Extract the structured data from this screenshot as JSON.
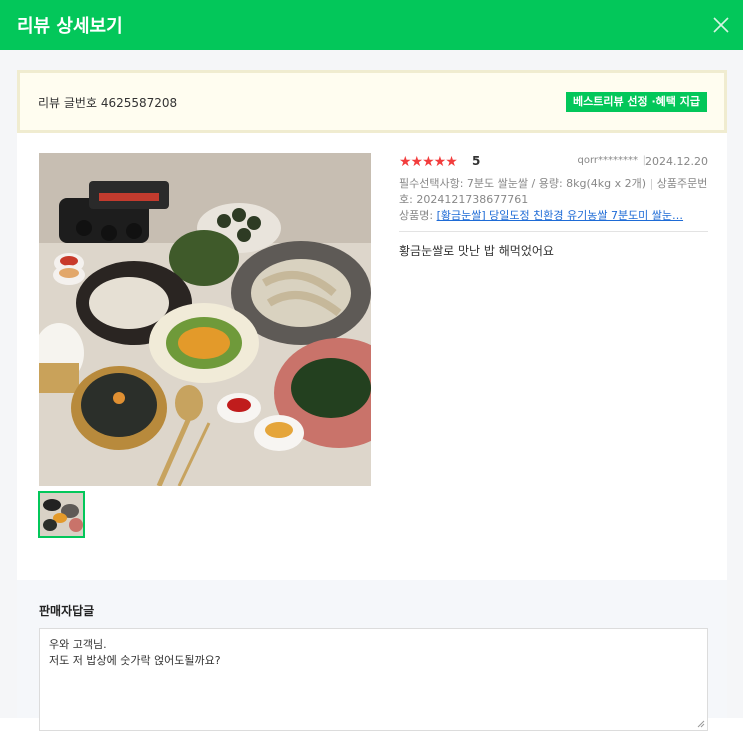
{
  "modal": {
    "title": "리뷰 상세보기",
    "close_icon": "close-icon"
  },
  "notice": {
    "review_number": "리뷰 글번호 4625587208",
    "badge": "베스트리뷰 선정 ·혜택 지급"
  },
  "review": {
    "stars": "★★★★★",
    "score": "5",
    "rating_value": 5,
    "rating_max": 5,
    "user": "qorr********",
    "date": "2024.12.20",
    "options_text": "필수선택사항: 7분도 쌀눈쌀 / 용량: 8kg(4kg x 2개)",
    "order_label": "상품주문번호: 2024121738677761",
    "product_label": "상품명:",
    "product_link": "[황금눈쌀] 당일도정 친환경 유기농쌀 7분도미 쌀눈…",
    "content": "황금눈쌀로 맛난 밥 해먹었어요",
    "accent_color": "#03c75a",
    "star_color": "#f23d3d"
  },
  "seller": {
    "heading": "판매자답글",
    "reply_lines": [
      "우와 고객님.",
      "저도 저 밥상에 숫가락 얹어도될까요?"
    ]
  }
}
